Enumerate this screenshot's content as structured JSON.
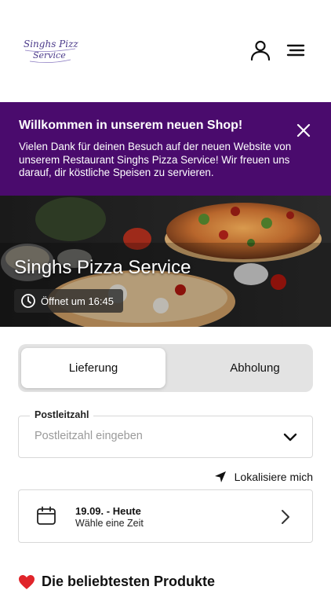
{
  "header": {
    "logo_text_line1": "Singhs Pizza",
    "logo_text_line2": "Service"
  },
  "banner": {
    "title": "Willkommen in unserem neuen Shop!",
    "text": "Vielen Dank für deinen Besuch auf der neuen Website von unserem Restaurant Singhs Pizza Service! Wir freuen uns darauf, dir köstliche Speisen zu servieren.",
    "background_color": "#4a0b6d"
  },
  "hero": {
    "title": "Singhs Pizza Service",
    "status": "Öffnet um 16:45"
  },
  "mode_toggle": {
    "options": [
      "Lieferung",
      "Abholung"
    ],
    "selected": "Lieferung"
  },
  "postal": {
    "label": "Postleitzahl",
    "placeholder": "Postleitzahl eingeben",
    "value": ""
  },
  "locate": {
    "label": "Lokalisiere mich"
  },
  "time": {
    "date": "19.09. - Heute",
    "subtitle": "Wähle eine Zeit"
  },
  "popular": {
    "title": "Die beliebtesten Produkte"
  },
  "icons": {
    "user": "user-icon",
    "menu": "hamburger-menu-icon",
    "close": "close-icon",
    "clock": "clock-icon",
    "chevron_down": "chevron-down-icon",
    "location": "location-arrow-icon",
    "calendar": "calendar-icon",
    "chevron_right": "chevron-right-icon",
    "heart": "heart-icon"
  }
}
